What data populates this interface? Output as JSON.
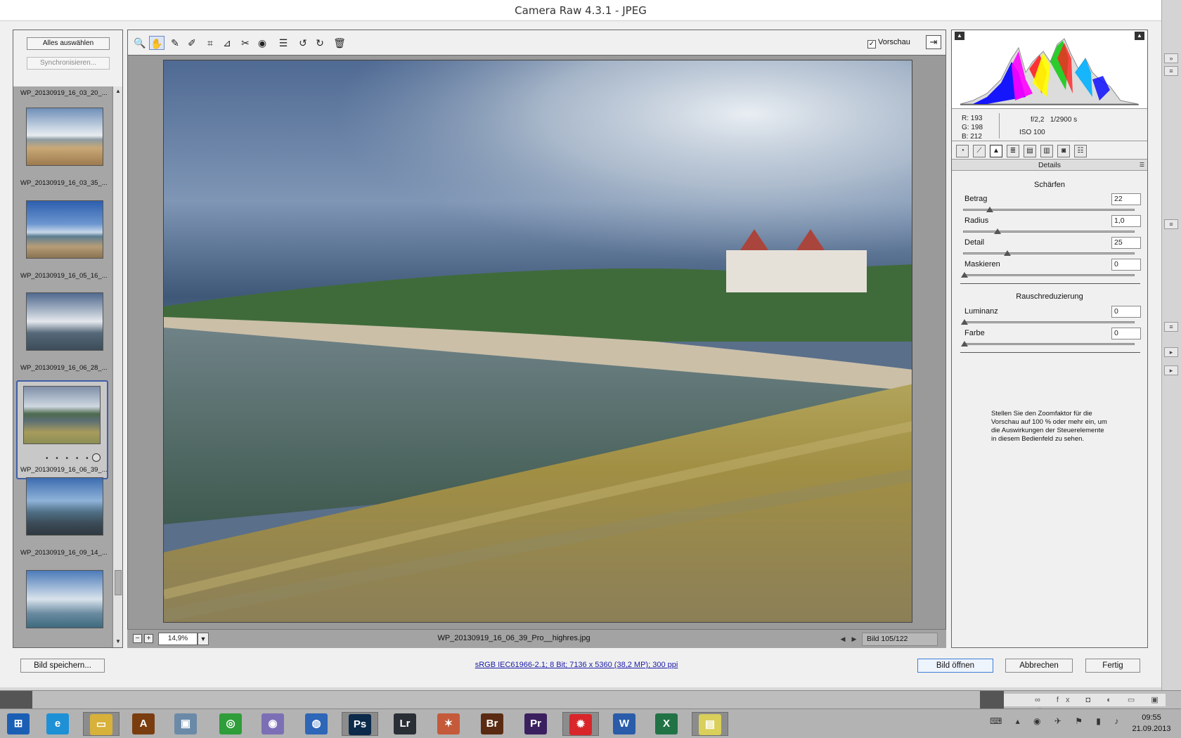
{
  "window": {
    "title": "Camera Raw 4.3.1 - JPEG"
  },
  "filmstrip": {
    "select_all": "Alles auswählen",
    "synchronize": "Synchronisieren...",
    "items": [
      {
        "name": "WP_20130919_16_03_20_..."
      },
      {
        "name": "WP_20130919_16_03_35_..."
      },
      {
        "name": "WP_20130919_16_05_16_..."
      },
      {
        "name": "WP_20130919_16_06_28_..."
      },
      {
        "name": "WP_20130919_16_06_39_...",
        "selected": true,
        "stars": "• • • • •"
      },
      {
        "name": "WP_20130919_16_09_14_..."
      }
    ]
  },
  "toolbar": {
    "tools": [
      {
        "icon": "zoom-icon",
        "glyph": "🔍"
      },
      {
        "icon": "hand-icon",
        "glyph": "✋",
        "active": true
      },
      {
        "icon": "white-balance-icon",
        "glyph": "✎"
      },
      {
        "icon": "color-sampler-icon",
        "glyph": "✐"
      },
      {
        "icon": "crop-icon",
        "glyph": "⌗"
      },
      {
        "icon": "straighten-icon",
        "glyph": "⊿"
      },
      {
        "icon": "retouch-icon",
        "glyph": "✂"
      },
      {
        "icon": "red-eye-icon",
        "glyph": "◉"
      },
      {
        "icon": "preferences-icon",
        "glyph": "☰"
      },
      {
        "icon": "rotate-left-icon",
        "glyph": "↺"
      },
      {
        "icon": "rotate-right-icon",
        "glyph": "↻"
      },
      {
        "icon": "trash-icon",
        "glyph": "🗑"
      }
    ],
    "preview_label": "Vorschau",
    "preview_checked": true
  },
  "status": {
    "zoom": "14,9%",
    "filename": "WP_20130919_16_06_39_Pro__highres.jpg",
    "counter": "Bild 105/122"
  },
  "readout": {
    "r": "R:  193",
    "g": "G:  198",
    "b": "B:  212",
    "aperture": "f/2,2",
    "shutter": "1/2900 s",
    "iso": "ISO 100"
  },
  "panel": {
    "title": "Details",
    "sharpen_title": "Schärfen",
    "sharpen": [
      {
        "label": "Betrag",
        "value": "22",
        "fraction": 0.147
      },
      {
        "label": "Radius",
        "value": "1,0",
        "fraction": 0.193
      },
      {
        "label": "Detail",
        "value": "25",
        "fraction": 0.25
      },
      {
        "label": "Maskieren",
        "value": "0",
        "fraction": 0
      }
    ],
    "noise_title": "Rauschreduzierung",
    "noise": [
      {
        "label": "Luminanz",
        "value": "0",
        "fraction": 0
      },
      {
        "label": "Farbe",
        "value": "0",
        "fraction": 0
      }
    ],
    "hint": "Stellen Sie den Zoomfaktor für die Vorschau auf 100 % oder mehr ein, um die Auswirkungen der Steuerelemente in diesem Bedienfeld zu sehen."
  },
  "footer": {
    "save": "Bild speichern...",
    "info": "sRGB IEC61966-2.1; 8 Bit; 7136 x 5360 (38,2 MP); 300 ppi",
    "open": "Bild öffnen",
    "cancel": "Abbrechen",
    "done": "Fertig"
  },
  "taskbar": {
    "apps": [
      {
        "name": "windows-start-icon",
        "glyph": "⊞",
        "color": "#1b5fb5"
      },
      {
        "name": "internet-explorer-icon",
        "glyph": "e",
        "color": "#1e90d6"
      },
      {
        "name": "file-explorer-icon",
        "glyph": "▭",
        "color": "#d8b13a",
        "active": true
      },
      {
        "name": "illustrator-icon",
        "glyph": "A",
        "color": "#7a3d10"
      },
      {
        "name": "photo-viewer-icon",
        "glyph": "▣",
        "color": "#6b8aa8"
      },
      {
        "name": "chrome-icon",
        "glyph": "◎",
        "color": "#2f9d3a"
      },
      {
        "name": "dvd-icon",
        "glyph": "◉",
        "color": "#7d6fb5"
      },
      {
        "name": "app-icon",
        "glyph": "◍",
        "color": "#2e66b8"
      },
      {
        "name": "photoshop-icon",
        "glyph": "Ps",
        "color": "#0c2a4a",
        "active": true
      },
      {
        "name": "lightroom-icon",
        "glyph": "Lr",
        "color": "#2a2f36"
      },
      {
        "name": "vector-app-icon",
        "glyph": "✶",
        "color": "#c45a3a"
      },
      {
        "name": "bridge-icon",
        "glyph": "Br",
        "color": "#5a2b12"
      },
      {
        "name": "premiere-icon",
        "glyph": "Pr",
        "color": "#3b2060"
      },
      {
        "name": "paint-app-icon",
        "glyph": "✹",
        "color": "#d8262b",
        "active": true
      },
      {
        "name": "word-icon",
        "glyph": "W",
        "color": "#2a5caa"
      },
      {
        "name": "excel-icon",
        "glyph": "X",
        "color": "#217346"
      },
      {
        "name": "sticky-notes-icon",
        "glyph": "▤",
        "color": "#d9cf5a",
        "active": true
      }
    ],
    "time": "09:55",
    "date": "21.09.2013"
  },
  "colors": {
    "accent": "#3f5fa8",
    "link": "#1a1aa6",
    "panel": "#f0f0f0",
    "canvas": "#9a9a9a"
  }
}
